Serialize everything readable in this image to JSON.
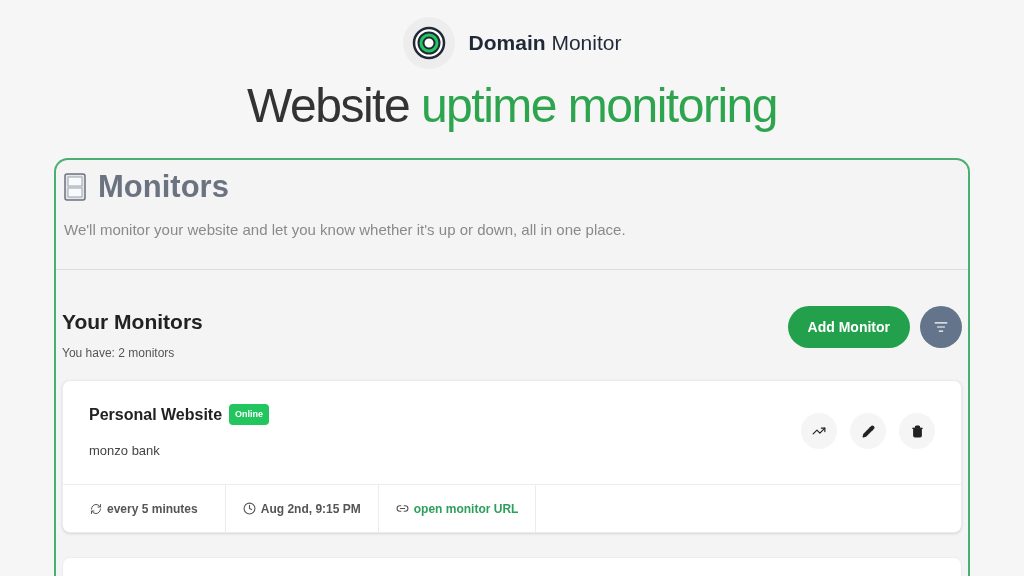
{
  "brand": {
    "name_bold": "Domain",
    "name_rest": "Monitor"
  },
  "headline": {
    "plain": "Website",
    "accent": "uptime monitoring"
  },
  "panel": {
    "title": "Monitors",
    "description": "We'll monitor your website and let you know whether it's up or down, all in one place."
  },
  "monitors_section": {
    "title": "Your Monitors",
    "count": "You have: 2 monitors",
    "add_button": "Add Monitor"
  },
  "monitors": [
    {
      "name": "Personal Website",
      "status": {
        "label": "Online",
        "online": true
      },
      "description": "monzo bank",
      "interval": "every 5 minutes",
      "time": "Aug 2nd, 9:15 PM",
      "link": "open monitor URL"
    }
  ]
}
